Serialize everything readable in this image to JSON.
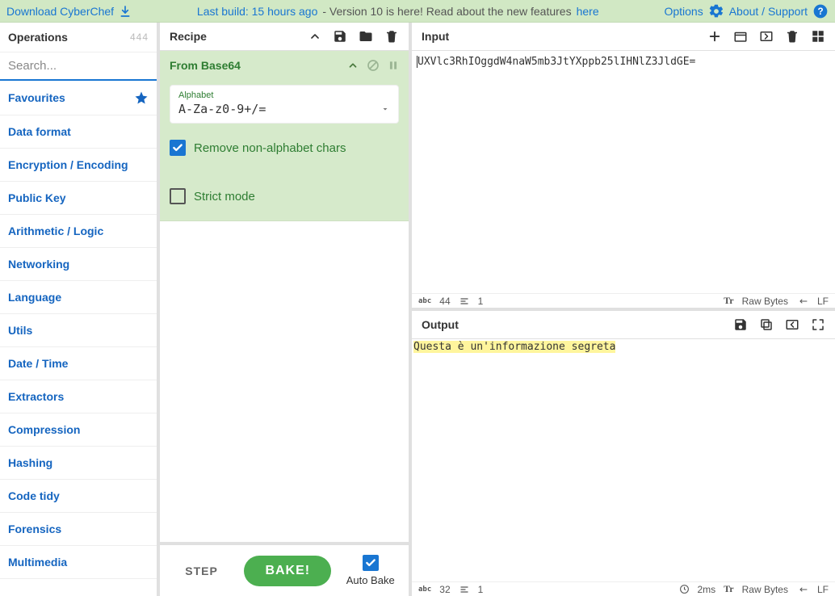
{
  "topbar": {
    "download": "Download CyberChef",
    "last_build_label": "Last build: 15 hours ago",
    "version_text": " - Version 10 is here! Read about the new features ",
    "here": "here",
    "options": "Options",
    "about": "About / Support"
  },
  "operations": {
    "title": "Operations",
    "count": "444",
    "search_placeholder": "Search...",
    "categories": [
      "Favourites",
      "Data format",
      "Encryption / Encoding",
      "Public Key",
      "Arithmetic / Logic",
      "Networking",
      "Language",
      "Utils",
      "Date / Time",
      "Extractors",
      "Compression",
      "Hashing",
      "Code tidy",
      "Forensics",
      "Multimedia"
    ]
  },
  "recipe": {
    "title": "Recipe",
    "op": {
      "name": "From Base64",
      "alphabet_label": "Alphabet",
      "alphabet_value": "A-Za-z0-9+/=",
      "remove_non_alpha": "Remove non-alphabet chars",
      "strict_mode": "Strict mode"
    },
    "step": "STEP",
    "bake": "BAKE!",
    "auto_bake": "Auto Bake"
  },
  "input": {
    "title": "Input",
    "text": "UXVlc3RhIOggdW4naW5mb3JtYXppb25lIHNlZ3JldGE=",
    "status_chars": "44",
    "status_lines": "1",
    "status_bytes_label": "Raw Bytes",
    "status_eol": "LF"
  },
  "output": {
    "title": "Output",
    "text": "Questa è un'informazione segreta",
    "status_chars": "32",
    "status_lines": "1",
    "status_time": "2ms",
    "status_bytes_label": "Raw Bytes",
    "status_eol": "LF"
  }
}
